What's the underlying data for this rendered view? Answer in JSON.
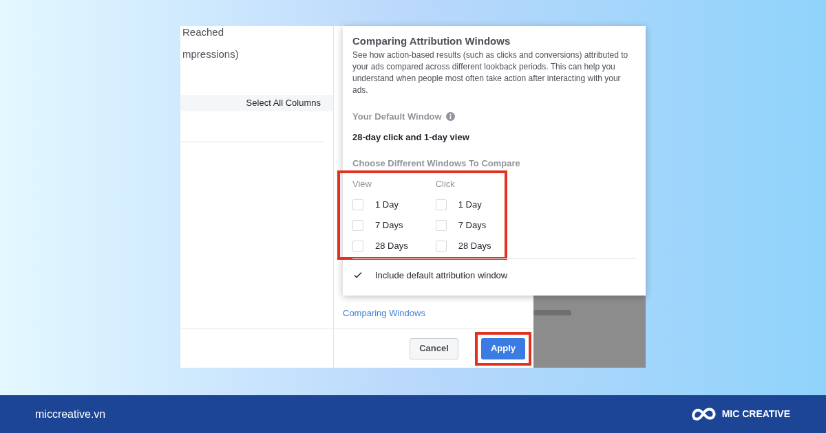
{
  "left_panel": {
    "items": [
      "Reached",
      "mpressions)"
    ],
    "select_all": "Select All Columns"
  },
  "popover": {
    "title": "Comparing Attribution Windows",
    "description": "See how action-based results (such as clicks and conversions) attributed to your ads compared across different lookback periods. This can help you understand when people most often take action after interacting with your ads.",
    "default_label": "Your Default Window",
    "default_value": "28-day click and 1-day view",
    "compare_label": "Choose Different Windows To Compare",
    "options_highlighted": true,
    "columns": [
      {
        "heading": "View",
        "options": [
          {
            "label": "1 Day",
            "checked": false
          },
          {
            "label": "7 Days",
            "checked": false
          },
          {
            "label": "28 Days",
            "checked": false
          }
        ]
      },
      {
        "heading": "Click",
        "options": [
          {
            "label": "1 Day",
            "checked": false
          },
          {
            "label": "7 Days",
            "checked": false
          },
          {
            "label": "28 Days",
            "checked": false
          }
        ]
      }
    ],
    "include_default": {
      "label": "Include default attribution window",
      "checked": true
    }
  },
  "link": "Comparing Windows",
  "buttons": [
    {
      "label": "Cancel",
      "kind": "secondary",
      "highlighted": false
    },
    {
      "label": "Apply",
      "kind": "primary",
      "highlighted": true
    }
  ],
  "footer": {
    "site": "miccreative.vn",
    "brand": "MIC CREATIVE"
  }
}
